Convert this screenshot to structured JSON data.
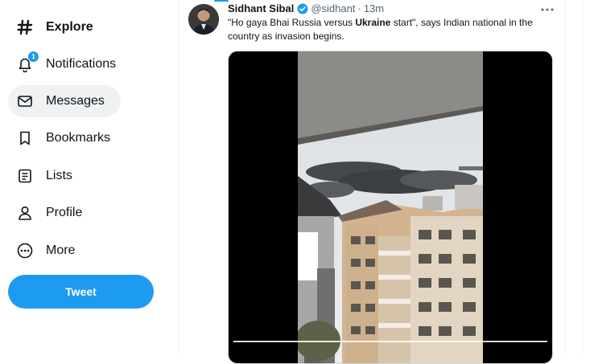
{
  "sidebar": {
    "items": [
      {
        "label": "Explore",
        "icon": "hashtag-icon"
      },
      {
        "label": "Notifications",
        "icon": "bell-icon",
        "badge": "1"
      },
      {
        "label": "Messages",
        "icon": "envelope-icon"
      },
      {
        "label": "Bookmarks",
        "icon": "bookmark-icon"
      },
      {
        "label": "Lists",
        "icon": "list-icon"
      },
      {
        "label": "Profile",
        "icon": "person-icon"
      },
      {
        "label": "More",
        "icon": "more-circle-icon"
      }
    ],
    "tweet_button": "Tweet"
  },
  "tweet": {
    "author_name": "Sidhant Sibal",
    "handle": "@sidhant",
    "separator": "·",
    "time": "13m",
    "text_before": "\"Ho gaya Bhai Russia versus ",
    "text_bold": "Ukraine",
    "text_after": " start\", says Indian national in the country as invasion begins."
  },
  "colors": {
    "accent": "#1d9bf0",
    "text": "#0f1419",
    "muted": "#536471",
    "active_nav_bg": "#eff1f2"
  }
}
